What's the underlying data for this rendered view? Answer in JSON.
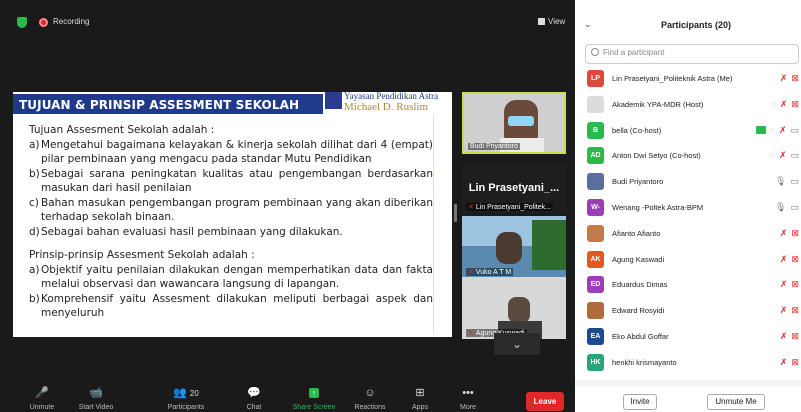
{
  "topbar": {
    "recording_label": "Recording",
    "view_label": "View"
  },
  "slide": {
    "title": "TUJUAN & PRINSIP ASSESMENT SEKOLAH",
    "logo_line1": "Yayasan Pendidikan Astra",
    "logo_line2": "Michael D. Ruslim",
    "intro1": "Tujuan Assesment Sekolah adalah :",
    "list1": [
      {
        "mark": "a)",
        "text": "Mengetahui bagaimana kelayakan & kinerja sekolah dilihat dari 4 (empat) pilar pembinaan yang mengacu pada standar Mutu Pendidikan"
      },
      {
        "mark": "b)",
        "text": "Sebagai sarana peningkatan kualitas atau pengembangan berdasarkan masukan dari hasil penilaian"
      },
      {
        "mark": "c)",
        "text": "Bahan masukan pengembangan program pembinaan yang akan diberikan terhadap sekolah binaan."
      },
      {
        "mark": "d)",
        "text": "Sebagai bahan evaluasi hasil pembinaan yang dilakukan."
      }
    ],
    "intro2": "Prinsip-prinsip Assesment Sekolah adalah :",
    "list2": [
      {
        "mark": "a)",
        "text": "Objektif yaitu penilaian dilakukan dengan memperhatikan data dan fakta melalui observasi dan wawancara langsung di lapangan."
      },
      {
        "mark": "b)",
        "text": "Komprehensif yaitu Assesment dilakukan meliputi berbagai aspek dan menyeluruh"
      }
    ]
  },
  "tiles": [
    {
      "name": "Budi Priyantoro"
    },
    {
      "big": "Lin Prasetyani_...",
      "name": "Lin Prasetyani_Politek..."
    },
    {
      "name": "Vuko A T M"
    },
    {
      "name": "Agung Kuswadi"
    }
  ],
  "toolbar": [
    {
      "icon": "🎤",
      "label": "Unmute"
    },
    {
      "icon": "📹",
      "label": "Start Video"
    },
    {
      "icon": "👥",
      "count": "20",
      "label": "Participants"
    },
    {
      "icon": "💬",
      "label": "Chat"
    },
    {
      "icon": "↑",
      "label": "Share Screen"
    },
    {
      "icon": "☺",
      "label": "Reactions"
    },
    {
      "icon": "⊞",
      "label": "Apps"
    },
    {
      "icon": "•••",
      "label": "More"
    }
  ],
  "leave_label": "Leave",
  "panel": {
    "title": "Participants (20)",
    "search_placeholder": "Find a participant",
    "participants": [
      {
        "initials": "LP",
        "color": "#e0483e",
        "name": "Lin Prasetyani_Politeknik Astra (Me)",
        "icons": [
          "mic-off",
          "cam-off"
        ]
      },
      {
        "initials": "",
        "color": "#dcdcdc",
        "name": "Akademik YPA-MDR (Host)",
        "icons": [
          "screen",
          "mic-off",
          "cam-off"
        ]
      },
      {
        "initials": "B",
        "color": "#2db84d",
        "name": "bella (Co-host)",
        "icons": [
          "share",
          "screen",
          "mic-off",
          "cam"
        ]
      },
      {
        "initials": "AD",
        "color": "#2db84d",
        "name": "Anton Dwi Setyo (Co-host)",
        "icons": [
          "screen",
          "mic-off",
          "cam"
        ]
      },
      {
        "initials": "",
        "color": "#5a6ea0",
        "name": "Budi Priyantoro",
        "icons": [
          "mic",
          "cam"
        ]
      },
      {
        "initials": "W-",
        "color": "#9b3fb5",
        "name": "Wenang -Poltek Astra-BPM",
        "icons": [
          "mic",
          "cam"
        ]
      },
      {
        "initials": "",
        "color": "#c47a4a",
        "name": "Afianto Afianto",
        "icons": [
          "mic-off",
          "cam-off"
        ]
      },
      {
        "initials": "AK",
        "color": "#e05a1e",
        "name": "Agung Kaswadi",
        "icons": [
          "mic-off",
          "cam-off"
        ]
      },
      {
        "initials": "ED",
        "color": "#9b3fb5",
        "name": "Eduardus Dimas",
        "icons": [
          "mic-off",
          "cam-off"
        ]
      },
      {
        "initials": "",
        "color": "#b06a3c",
        "name": "Edward Rosyidi",
        "icons": [
          "mic-off",
          "cam-off"
        ]
      },
      {
        "initials": "EA",
        "color": "#1f4a8a",
        "name": "Eko Abdul Goffar",
        "icons": [
          "mic-off",
          "cam-off"
        ]
      },
      {
        "initials": "HK",
        "color": "#2aa37a",
        "name": "henkhi krismayanto",
        "icons": [
          "mic-off",
          "cam-off"
        ]
      }
    ],
    "invite_label": "Invite",
    "unmute_me_label": "Unmute Me"
  }
}
